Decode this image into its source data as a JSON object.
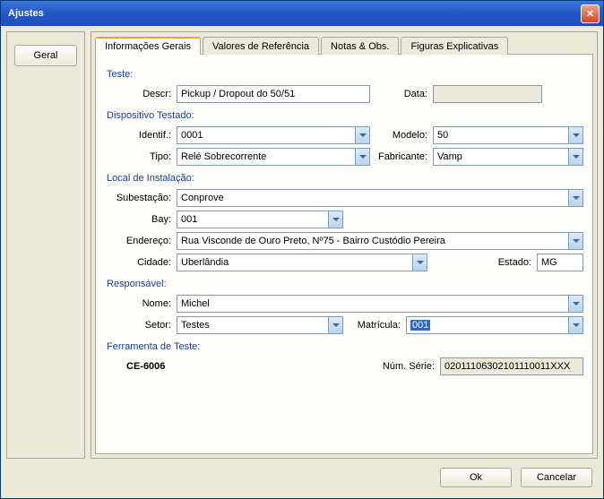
{
  "title": "Ajustes",
  "sidebar": {
    "geral": "Geral"
  },
  "tabs": [
    "Informações Gerais",
    "Valores de Referência",
    "Notas & Obs.",
    "Figuras Explicativas"
  ],
  "teste": {
    "heading": "Teste:",
    "descr_lbl": "Descr:",
    "descr": "Pickup / Dropout do 50/51",
    "data_lbl": "Data:",
    "data": ""
  },
  "disp": {
    "heading": "Dispositivo Testado:",
    "identif_lbl": "Identif.:",
    "identif": "0001",
    "modelo_lbl": "Modelo:",
    "modelo": "50",
    "tipo_lbl": "Tipo:",
    "tipo": "Relé Sobrecorrente",
    "fabricante_lbl": "Fabricante:",
    "fabricante": "Vamp"
  },
  "local": {
    "heading": "Local de Instalação:",
    "sub_lbl": "Subestação:",
    "sub": "Conprove",
    "bay_lbl": "Bay:",
    "bay": "001",
    "end_lbl": "Endereço:",
    "end": "Rua Visconde de Ouro Preto, Nº75 - Bairro Custódio Pereira",
    "cid_lbl": "Cidade:",
    "cid": "Uberlândia",
    "est_lbl": "Estado:",
    "est": "MG"
  },
  "resp": {
    "heading": "Responsável:",
    "nome_lbl": "Nome:",
    "nome": "Michel",
    "setor_lbl": "Setor:",
    "setor": "Testes",
    "mat_lbl": "Matrícula:",
    "mat": "001"
  },
  "ferr": {
    "heading": "Ferramenta de Teste:",
    "nome": "CE-6006",
    "serie_lbl": "Núm. Série:",
    "serie": "02011106302101110011XXX"
  },
  "buttons": {
    "ok": "Ok",
    "cancel": "Cancelar"
  }
}
